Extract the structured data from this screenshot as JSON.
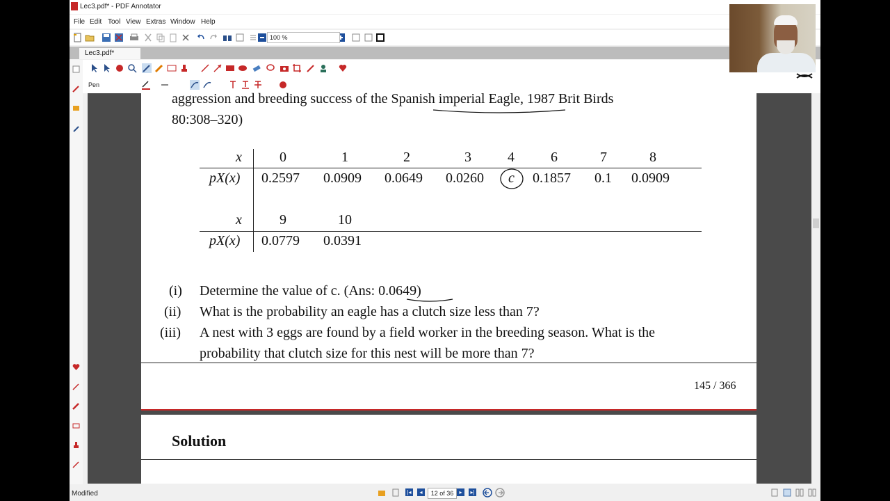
{
  "window": {
    "title": "Lec3.pdf* - PDF Annotator"
  },
  "menu": [
    "File",
    "Edit",
    "Tool",
    "View",
    "Extras",
    "Window",
    "Help"
  ],
  "toolbar": {
    "zoom": "100 %"
  },
  "tab": {
    "label": "Lec3.pdf*"
  },
  "annotation_toolbar": {
    "tool_label": "Pen"
  },
  "page1": {
    "line1": "aggression and breeding success of the Spanish imperial Eagle, 1987 Brit Birds",
    "line2": "80:308–320)",
    "table1": {
      "row_x_label": "x",
      "row_p_label": "pX(x)",
      "x": [
        "0",
        "1",
        "2",
        "3",
        "4",
        "6",
        "7",
        "8"
      ],
      "p": [
        "0.2597",
        "0.0909",
        "0.0649",
        "0.0260",
        "c",
        "0.1857",
        "0.1",
        "0.0909"
      ]
    },
    "table2": {
      "row_x_label": "x",
      "row_p_label": "pX(x)",
      "x": [
        "9",
        "10"
      ],
      "p": [
        "0.0779",
        "0.0391"
      ]
    },
    "questions": [
      {
        "num": "(i)",
        "text": "Determine the value of c. (Ans: 0.0649)"
      },
      {
        "num": "(ii)",
        "text": "What is the probability an eagle has a clutch size less than 7?"
      },
      {
        "num": "(iii)",
        "text": "A nest with 3 eggs are found by a field worker in the breeding season. What is the"
      }
    ],
    "question3_cont": "probability that clutch size for this nest will be more than 7?",
    "page_number": "145 / 366"
  },
  "page2": {
    "heading": "Solution"
  },
  "status": {
    "text": "Modified",
    "page_indicator": "12 of 36"
  },
  "colors": {
    "accent_red": "#c62828",
    "nav_blue": "#1e4f9c"
  }
}
